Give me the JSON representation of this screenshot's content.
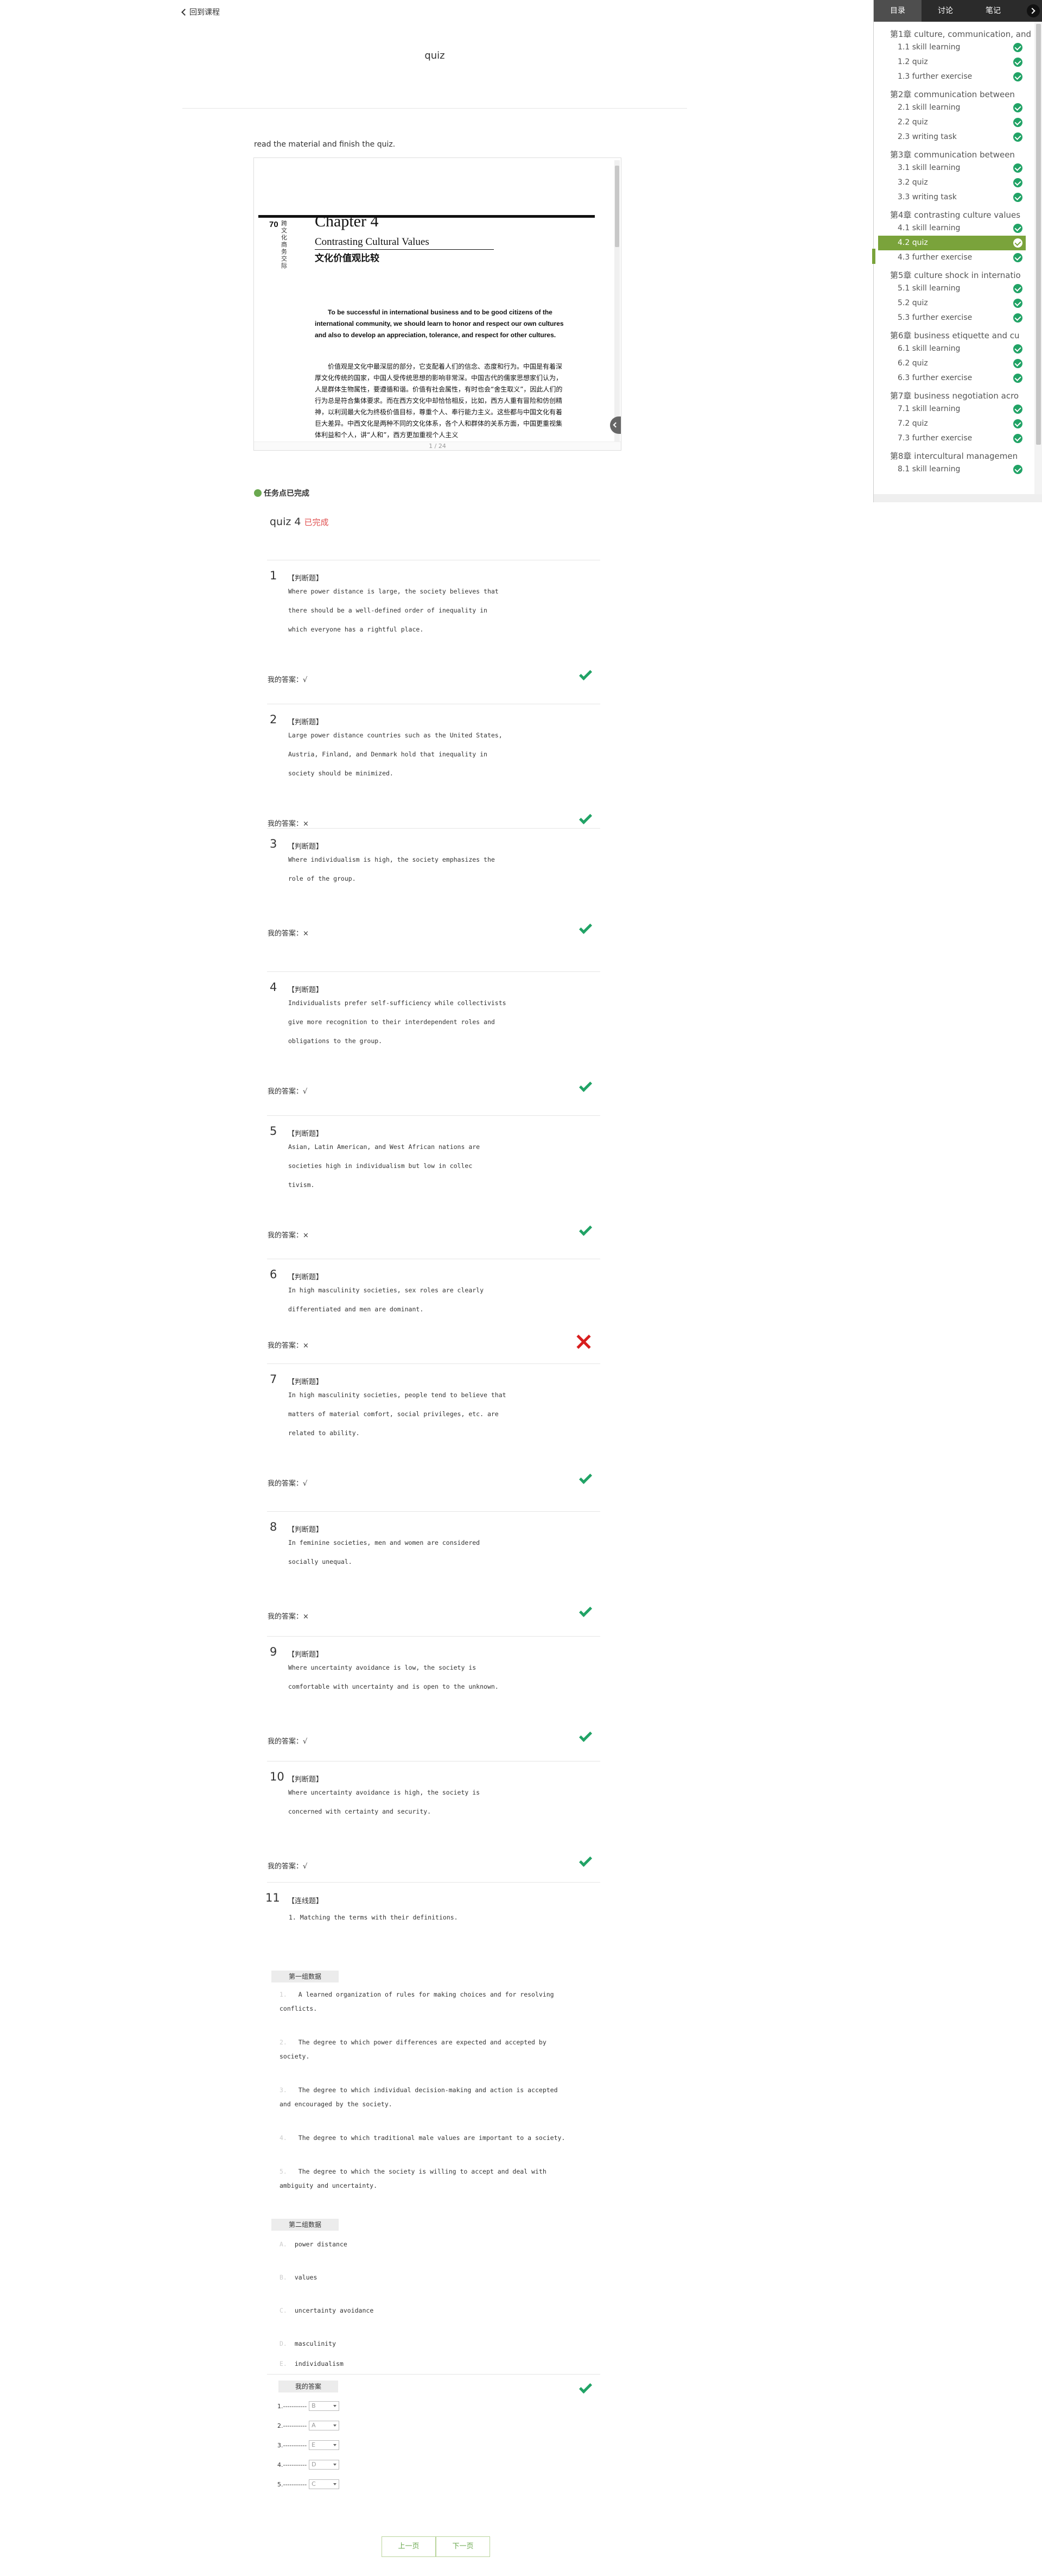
{
  "nav": {
    "back_label": "回到课程",
    "page_title": "quiz"
  },
  "instruction": "read the material and finish the quiz.",
  "viewer": {
    "page_num": "70",
    "vertical_label": "跨文化商务交际",
    "chapter_label": "Chapter 4",
    "subtitle": "Contrasting Cultural Values",
    "cn_title": "文化价值观比较",
    "intro_en": "To be successful in international business and to be good citizens of the international community, we should learn to honor and respect our own cultures and also to develop an appreciation, tolerance, and respect for other cultures.",
    "intro_cn": "价值观是文化中最深层的部分，它支配着人们的信念、态度和行为。中国是有着深厚文化传统的国家，中国人受传统思想的影响非常深。中国古代的儒家思想家们认为，人是群体生物属性，要遵循和谐。价值有社会属性，有时也会“舍生取义”，因此人们的行为总是符合集体要求。而在西方文化中却恰恰相反，比如，西方人重有冒险和仿创精神，以利润最大化为终极价值目标，尊重个人、奉行能力主义。这些都与中国文化有着巨大差异。中西文化是两种不同的文化体系，各个人和群体的关系方面，中国更重视集体利益和个人，讲“人和”，西方更加重视个人主义",
    "pager": "1 / 24"
  },
  "status_label": "任务点已完成",
  "quiz": {
    "title": "quiz 4",
    "status": "已完成"
  },
  "answer_label": "我的答案：",
  "questions": [
    {
      "num": "1",
      "type": "【判断题】",
      "lines": [
        "Where power distance is large, the society believes that",
        "there should be a well-defined order of inequality in",
        "which everyone has a rightful place."
      ],
      "answer": "√",
      "correct": true
    },
    {
      "num": "2",
      "type": "【判断题】",
      "lines": [
        "Large power distance countries such as the United States,",
        "Austria, Finland,  and Denmark hold that inequality in",
        "society should be minimized."
      ],
      "answer": "×",
      "correct": true
    },
    {
      "num": "3",
      "type": "【判断题】",
      "lines": [
        "Where individualism is high, the society emphasizes the",
        "role of the group."
      ],
      "answer": "×",
      "correct": true
    },
    {
      "num": "4",
      "type": "【判断题】",
      "lines": [
        "Individualists prefer self-sufficiency while collectivists",
        "give more recognition  to their interdependent roles and",
        "obligations to the group."
      ],
      "answer": "√",
      "correct": true
    },
    {
      "num": "5",
      "type": "【判断题】",
      "lines": [
        "Asian,  Latin  American,  and  West  African  nations  are",
        "  societies  high  in  individualism  but  low  in  collec",
        "tivism."
      ],
      "answer": "×",
      "correct": true
    },
    {
      "num": "6",
      "type": "【判断题】",
      "lines": [
        "In high masculinity societies, sex roles are clearly",
        "differentiated and men are  dominant."
      ],
      "answer": "×",
      "correct": false
    },
    {
      "num": "7",
      "type": "【判断题】",
      "lines": [
        "In high masculinity societies, people tend to believe that",
        "matters of material  comfort, social privileges, etc. are",
        "related to ability."
      ],
      "answer": "√",
      "correct": true
    },
    {
      "num": "8",
      "type": "【判断题】",
      "lines": [
        "In feminine societies, men and women are considered",
        "socially unequal."
      ],
      "answer": "×",
      "correct": true
    },
    {
      "num": "9",
      "type": "【判断题】",
      "lines": [
        "Where uncertainty avoidance is low, the society is",
        "comfortable with uncertainty and is open to the unknown."
      ],
      "answer": "√",
      "correct": true
    },
    {
      "num": "10",
      "type": "【判断题】",
      "lines": [
        "Where uncertainty avoidance is high, the society is",
        "concerned with certainty  and security."
      ],
      "answer": "√",
      "correct": true
    }
  ],
  "q11": {
    "num": "11",
    "type": "【连线题】",
    "prompt": "1.  Matching the terms with their definitions.",
    "group1_label": "第一组数据",
    "group1": [
      {
        "k": "1.",
        "lines": [
          "   A learned organization of rules for making choices and for resolving",
          "conflicts."
        ]
      },
      {
        "k": "2.",
        "lines": [
          " The degree to which power differences are expected and accepted by",
          "society."
        ]
      },
      {
        "k": "3.",
        "lines": [
          "  The degree to which individual decision-making and action is accepted",
          "and  encouraged by the society."
        ]
      },
      {
        "k": "4.",
        "lines": [
          " The degree to which traditional male values are important to a society."
        ]
      },
      {
        "k": "5.",
        "lines": [
          " The degree to which the society is willing to accept and deal with",
          "ambiguity  and uncertainty."
        ]
      }
    ],
    "group2_label": "第二组数据",
    "group2": [
      {
        "k": "A.",
        "text": "power distance"
      },
      {
        "k": "B.",
        "text": "values"
      },
      {
        "k": "C.",
        "text": "uncertainty avoidance"
      },
      {
        "k": "D.",
        "text": "masculinity"
      },
      {
        "k": "E.",
        "text": "individualism"
      }
    ],
    "my_answer_label": "我的答案",
    "answers": [
      {
        "k": "1.-----------",
        "v": "B"
      },
      {
        "k": "2.-----------",
        "v": "A"
      },
      {
        "k": "3.-----------",
        "v": "E"
      },
      {
        "k": "4.-----------",
        "v": "D"
      },
      {
        "k": "5.-----------",
        "v": "C"
      }
    ]
  },
  "buttons": {
    "prev": "上一页",
    "next": "下一页"
  },
  "sidebar": {
    "tabs": [
      "目录",
      "讨论",
      "笔记"
    ],
    "chapters": [
      {
        "title": "第1章 culture, communication, and",
        "sections": [
          "1.1 skill learning",
          "1.2 quiz",
          "1.3 further exercise"
        ]
      },
      {
        "title": "第2章 communication between",
        "sections": [
          "2.1 skill learning",
          "2.2 quiz",
          "2.3 writing task"
        ]
      },
      {
        "title": "第3章 communication between",
        "sections": [
          "3.1 skill learning",
          "3.2 quiz",
          "3.3 writing task"
        ]
      },
      {
        "title": "第4章 contrasting culture values",
        "sections": [
          "4.1 skill learning",
          "4.2 quiz",
          "4.3 further exercise"
        ]
      },
      {
        "title": "第5章 culture shock in internatio",
        "sections": [
          "5.1 skill learning",
          "5.2 quiz",
          "5.3 further exercise"
        ]
      },
      {
        "title": "第6章 business etiquette and cu",
        "sections": [
          "6.1 skill learning",
          "6.2 quiz",
          "6.3 further exercise"
        ]
      },
      {
        "title": "第7章 business negotiation acro",
        "sections": [
          "7.1 skill learning",
          "7.2 quiz",
          "7.3 further exercise"
        ]
      },
      {
        "title": "第8章 intercultural managemen",
        "sections": [
          "8.1 skill learning"
        ]
      }
    ],
    "current": "4.2 quiz"
  },
  "colors": {
    "accent": "#7aa33b",
    "correct": "#21a366",
    "wrong": "#d81e1e",
    "done": "#e05050"
  }
}
